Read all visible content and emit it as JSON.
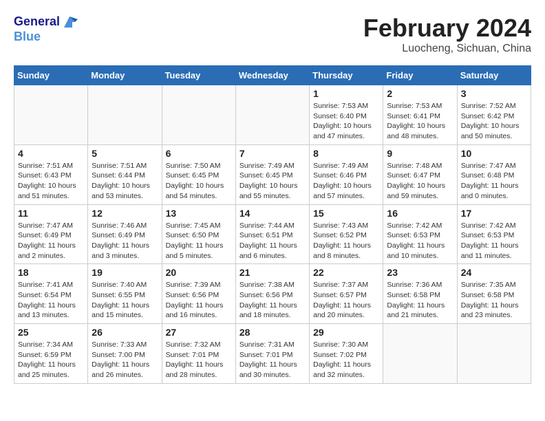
{
  "header": {
    "logo_line1": "General",
    "logo_line2": "Blue",
    "month": "February 2024",
    "location": "Luocheng, Sichuan, China"
  },
  "weekdays": [
    "Sunday",
    "Monday",
    "Tuesday",
    "Wednesday",
    "Thursday",
    "Friday",
    "Saturday"
  ],
  "weeks": [
    [
      {
        "day": "",
        "info": ""
      },
      {
        "day": "",
        "info": ""
      },
      {
        "day": "",
        "info": ""
      },
      {
        "day": "",
        "info": ""
      },
      {
        "day": "1",
        "info": "Sunrise: 7:53 AM\nSunset: 6:40 PM\nDaylight: 10 hours and 47 minutes."
      },
      {
        "day": "2",
        "info": "Sunrise: 7:53 AM\nSunset: 6:41 PM\nDaylight: 10 hours and 48 minutes."
      },
      {
        "day": "3",
        "info": "Sunrise: 7:52 AM\nSunset: 6:42 PM\nDaylight: 10 hours and 50 minutes."
      }
    ],
    [
      {
        "day": "4",
        "info": "Sunrise: 7:51 AM\nSunset: 6:43 PM\nDaylight: 10 hours and 51 minutes."
      },
      {
        "day": "5",
        "info": "Sunrise: 7:51 AM\nSunset: 6:44 PM\nDaylight: 10 hours and 53 minutes."
      },
      {
        "day": "6",
        "info": "Sunrise: 7:50 AM\nSunset: 6:45 PM\nDaylight: 10 hours and 54 minutes."
      },
      {
        "day": "7",
        "info": "Sunrise: 7:49 AM\nSunset: 6:45 PM\nDaylight: 10 hours and 55 minutes."
      },
      {
        "day": "8",
        "info": "Sunrise: 7:49 AM\nSunset: 6:46 PM\nDaylight: 10 hours and 57 minutes."
      },
      {
        "day": "9",
        "info": "Sunrise: 7:48 AM\nSunset: 6:47 PM\nDaylight: 10 hours and 59 minutes."
      },
      {
        "day": "10",
        "info": "Sunrise: 7:47 AM\nSunset: 6:48 PM\nDaylight: 11 hours and 0 minutes."
      }
    ],
    [
      {
        "day": "11",
        "info": "Sunrise: 7:47 AM\nSunset: 6:49 PM\nDaylight: 11 hours and 2 minutes."
      },
      {
        "day": "12",
        "info": "Sunrise: 7:46 AM\nSunset: 6:49 PM\nDaylight: 11 hours and 3 minutes."
      },
      {
        "day": "13",
        "info": "Sunrise: 7:45 AM\nSunset: 6:50 PM\nDaylight: 11 hours and 5 minutes."
      },
      {
        "day": "14",
        "info": "Sunrise: 7:44 AM\nSunset: 6:51 PM\nDaylight: 11 hours and 6 minutes."
      },
      {
        "day": "15",
        "info": "Sunrise: 7:43 AM\nSunset: 6:52 PM\nDaylight: 11 hours and 8 minutes."
      },
      {
        "day": "16",
        "info": "Sunrise: 7:42 AM\nSunset: 6:53 PM\nDaylight: 11 hours and 10 minutes."
      },
      {
        "day": "17",
        "info": "Sunrise: 7:42 AM\nSunset: 6:53 PM\nDaylight: 11 hours and 11 minutes."
      }
    ],
    [
      {
        "day": "18",
        "info": "Sunrise: 7:41 AM\nSunset: 6:54 PM\nDaylight: 11 hours and 13 minutes."
      },
      {
        "day": "19",
        "info": "Sunrise: 7:40 AM\nSunset: 6:55 PM\nDaylight: 11 hours and 15 minutes."
      },
      {
        "day": "20",
        "info": "Sunrise: 7:39 AM\nSunset: 6:56 PM\nDaylight: 11 hours and 16 minutes."
      },
      {
        "day": "21",
        "info": "Sunrise: 7:38 AM\nSunset: 6:56 PM\nDaylight: 11 hours and 18 minutes."
      },
      {
        "day": "22",
        "info": "Sunrise: 7:37 AM\nSunset: 6:57 PM\nDaylight: 11 hours and 20 minutes."
      },
      {
        "day": "23",
        "info": "Sunrise: 7:36 AM\nSunset: 6:58 PM\nDaylight: 11 hours and 21 minutes."
      },
      {
        "day": "24",
        "info": "Sunrise: 7:35 AM\nSunset: 6:58 PM\nDaylight: 11 hours and 23 minutes."
      }
    ],
    [
      {
        "day": "25",
        "info": "Sunrise: 7:34 AM\nSunset: 6:59 PM\nDaylight: 11 hours and 25 minutes."
      },
      {
        "day": "26",
        "info": "Sunrise: 7:33 AM\nSunset: 7:00 PM\nDaylight: 11 hours and 26 minutes."
      },
      {
        "day": "27",
        "info": "Sunrise: 7:32 AM\nSunset: 7:01 PM\nDaylight: 11 hours and 28 minutes."
      },
      {
        "day": "28",
        "info": "Sunrise: 7:31 AM\nSunset: 7:01 PM\nDaylight: 11 hours and 30 minutes."
      },
      {
        "day": "29",
        "info": "Sunrise: 7:30 AM\nSunset: 7:02 PM\nDaylight: 11 hours and 32 minutes."
      },
      {
        "day": "",
        "info": ""
      },
      {
        "day": "",
        "info": ""
      }
    ]
  ]
}
